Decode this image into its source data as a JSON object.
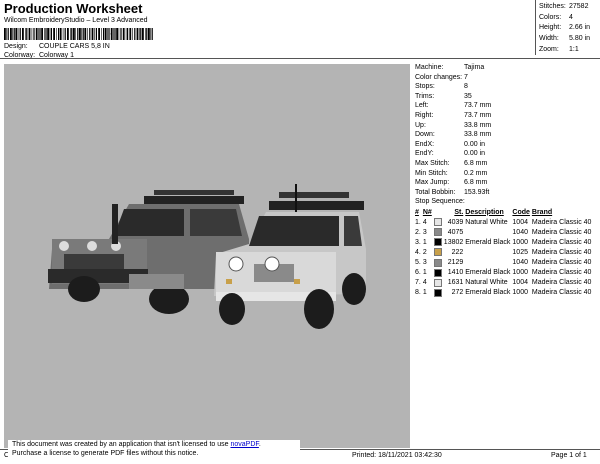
{
  "header": {
    "title": "Production Worksheet",
    "subtitle": "Wilcom EmbroideryStudio – Level 3 Advanced",
    "barcode_caption": ",",
    "design_label": "Design:",
    "design_value": "COUPLE CARS 5,8 IN",
    "colorway_label": "Colorway:",
    "colorway_value": "Colorway 1"
  },
  "stats": [
    {
      "label": "Stitches:",
      "value": "27582"
    },
    {
      "label": "Colors:",
      "value": "4"
    },
    {
      "label": "Height:",
      "value": "2.66 in"
    },
    {
      "label": "Width:",
      "value": "5.80 in"
    },
    {
      "label": "Zoom:",
      "value": "1:1"
    }
  ],
  "machine": [
    {
      "label": "Machine:",
      "value": "Tajima"
    },
    {
      "label": "Color changes:",
      "value": "7"
    },
    {
      "label": "Stops:",
      "value": "8"
    },
    {
      "label": "Trims:",
      "value": "35"
    },
    {
      "label": "Left:",
      "value": "73.7 mm"
    },
    {
      "label": "Right:",
      "value": "73.7 mm"
    },
    {
      "label": "Up:",
      "value": "33.8 mm"
    },
    {
      "label": "Down:",
      "value": "33.8 mm"
    },
    {
      "label": "EndX:",
      "value": "0.00 in"
    },
    {
      "label": "EndY:",
      "value": "0.00 in"
    },
    {
      "label": "Max Stitch:",
      "value": "6.8 mm"
    },
    {
      "label": "Min Stitch:",
      "value": "0.2 mm"
    },
    {
      "label": "Max Jump:",
      "value": "6.8 mm"
    },
    {
      "label": "Total Bobbin:",
      "value": "153.93ft"
    }
  ],
  "sequence": {
    "title": "Stop Sequence:",
    "headers": [
      "#",
      "N#",
      "",
      "St.",
      "Description",
      "Code",
      "Brand"
    ],
    "rows": [
      {
        "num": "1.",
        "n": "4",
        "color": "#e6e6e6",
        "st": "4039",
        "desc": "Natural White",
        "code": "1004",
        "brand": "Madeira Classic 40"
      },
      {
        "num": "2.",
        "n": "3",
        "color": "#8a8a8a",
        "st": "4075",
        "desc": "",
        "code": "1040",
        "brand": "Madeira Classic 40"
      },
      {
        "num": "3.",
        "n": "1",
        "color": "#000000",
        "st": "13802",
        "desc": "Emerald Black",
        "code": "1000",
        "brand": "Madeira Classic 40"
      },
      {
        "num": "4.",
        "n": "2",
        "color": "#c8a04a",
        "st": "222",
        "desc": "",
        "code": "1025",
        "brand": "Madeira Classic 40"
      },
      {
        "num": "5.",
        "n": "3",
        "color": "#8a8a8a",
        "st": "2129",
        "desc": "",
        "code": "1040",
        "brand": "Madeira Classic 40"
      },
      {
        "num": "6.",
        "n": "1",
        "color": "#000000",
        "st": "1410",
        "desc": "Emerald Black",
        "code": "1000",
        "brand": "Madeira Classic 40"
      },
      {
        "num": "7.",
        "n": "4",
        "color": "#e6e6e6",
        "st": "1631",
        "desc": "Natural White",
        "code": "1004",
        "brand": "Madeira Classic 40"
      },
      {
        "num": "8.",
        "n": "1",
        "color": "#000000",
        "st": "272",
        "desc": "Emerald Black",
        "code": "1000",
        "brand": "Madeira Classic 40"
      }
    ]
  },
  "notice": {
    "line1_prefix": "This document was created by an application that isn't licensed to use ",
    "link": "novaPDF",
    "line1_suffix": ".",
    "line2": "Purchase a license to generate PDF files without this notice."
  },
  "footer": {
    "left": "Cr",
    "printed": "Printed: 18/11/2021 03:42:30",
    "page": "Page 1 of 1"
  }
}
